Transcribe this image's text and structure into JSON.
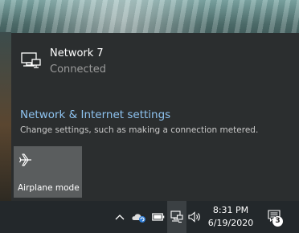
{
  "network": {
    "name": "Network 7",
    "status": "Connected"
  },
  "settings": {
    "link_label": "Network & Internet settings",
    "description": "Change settings, such as making a connection metered."
  },
  "quick_actions": [
    {
      "label": "Airplane mode",
      "icon": "airplane-icon",
      "state": "off"
    }
  ],
  "taskbar": {
    "tray_icons": [
      "chevron-up-icon",
      "onedrive-icon",
      "battery-icon",
      "network-icon",
      "volume-icon"
    ],
    "time": "8:31 PM",
    "date": "6/19/2020",
    "notification_count": "3"
  },
  "colors": {
    "flyout_bg": "#2b2e2f",
    "link": "#8ec3f0",
    "tile_bg": "#5a5d5e",
    "taskbar_bg": "#23282b"
  }
}
